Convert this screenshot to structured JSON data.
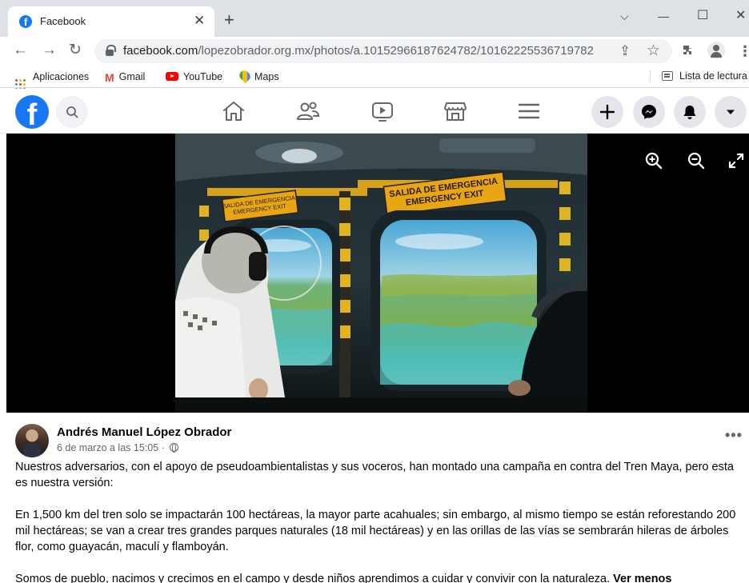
{
  "browser": {
    "tab_title": "Facebook",
    "tab_favicon": "facebook-icon",
    "tab_close": "✕",
    "new_tab": "+",
    "window_controls": {
      "collapse": "⌵",
      "minimize": "—",
      "maximize": "☐",
      "close": "✕"
    },
    "url_host": "facebook.com",
    "url_path": "/lopezobrador.org.mx/photos/a.10152966187624782/10162225536719782",
    "nav": {
      "back": "←",
      "forward": "→",
      "reload": "↻"
    },
    "omnibox_icons": {
      "share": "⇪",
      "bookmark": "☆"
    }
  },
  "bookmarks": {
    "items": [
      {
        "label": "Aplicaciones",
        "icon": "apps-grid-icon"
      },
      {
        "label": "Gmail",
        "icon": "gmail-icon"
      },
      {
        "label": "YouTube",
        "icon": "youtube-icon"
      },
      {
        "label": "Maps",
        "icon": "maps-icon"
      }
    ],
    "reading_list": "Lista de lectura"
  },
  "facebook_nav": {
    "icons": [
      "home-icon",
      "friends-icon",
      "watch-icon",
      "marketplace-icon",
      "menu-icon"
    ],
    "right_buttons": [
      "create-icon",
      "messenger-icon",
      "notifications-icon",
      "account-dropdown-icon"
    ],
    "colors": {
      "brand": "#1877f2",
      "button_bg": "#e4e6eb"
    }
  },
  "viewer": {
    "photo_signs": {
      "left_line1": "SALIDA DE EMERGENCIA",
      "left_line2": "EMERGENCY EXIT",
      "right_line1": "SALIDA DE EMERGENCIA",
      "right_line2": "EMERGENCY EXIT"
    },
    "tools": [
      "zoom-in-icon",
      "zoom-out-icon",
      "fullscreen-icon"
    ]
  },
  "post": {
    "author": "Andrés Manuel López Obrador",
    "timestamp": "6 de marzo a las 15:05 ·",
    "privacy_icon": "globe-icon",
    "more": "•••",
    "paragraphs": [
      "Nuestros adversarios, con el apoyo de pseudoambientalistas y sus voceros, han montado una campaña en contra del Tren Maya, pero esta es nuestra versión:",
      "En 1,500 km del tren solo se impactarán 100 hectáreas, la mayor parte acahuales; sin embargo, al mismo tiempo se están reforestando 200 mil hectáreas; se van a crear tres grandes parques naturales (18 mil hectáreas) y en las orillas de las vías se sembrarán hileras de árboles flor, como guayacán, maculí y flamboyán.",
      "Somos de pueblo, nacimos y crecimos en el campo y desde niños aprendimos a cuidar y convivir con la naturaleza."
    ],
    "see_less": "Ver menos"
  }
}
